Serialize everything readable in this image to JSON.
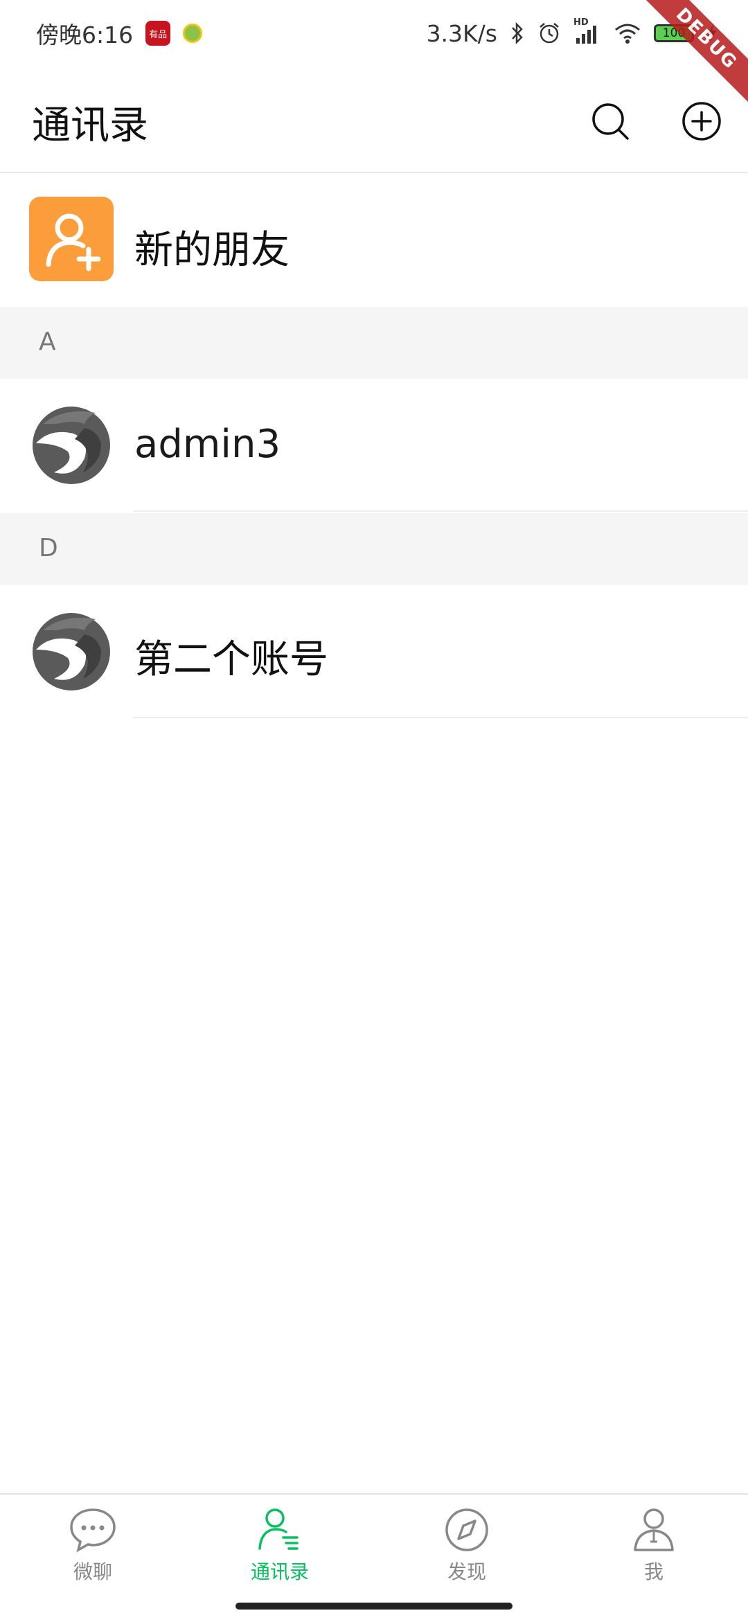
{
  "status_bar": {
    "time": "傍晚6:16",
    "app_icon_red_text": "有品",
    "net_speed": "3.3K/s",
    "network_badge": "HD",
    "battery": "100",
    "debug_label": "DEBUG"
  },
  "header": {
    "title": "通讯录"
  },
  "new_friends": {
    "label": "新的朋友"
  },
  "sections": [
    {
      "letter": "A",
      "contacts": [
        {
          "name": "admin3"
        }
      ]
    },
    {
      "letter": "D",
      "contacts": [
        {
          "name": "第二个账号"
        }
      ]
    }
  ],
  "bottom_nav": {
    "items": [
      {
        "label": "微聊",
        "icon": "chat-bubble-icon",
        "active": false
      },
      {
        "label": "通讯录",
        "icon": "contacts-icon",
        "active": true
      },
      {
        "label": "发现",
        "icon": "compass-icon",
        "active": false
      },
      {
        "label": "我",
        "icon": "profile-icon",
        "active": false
      }
    ]
  },
  "colors": {
    "accent": "#07c160",
    "new_friends_bg": "#fb9d3b",
    "section_bg": "#f5f5f5"
  }
}
